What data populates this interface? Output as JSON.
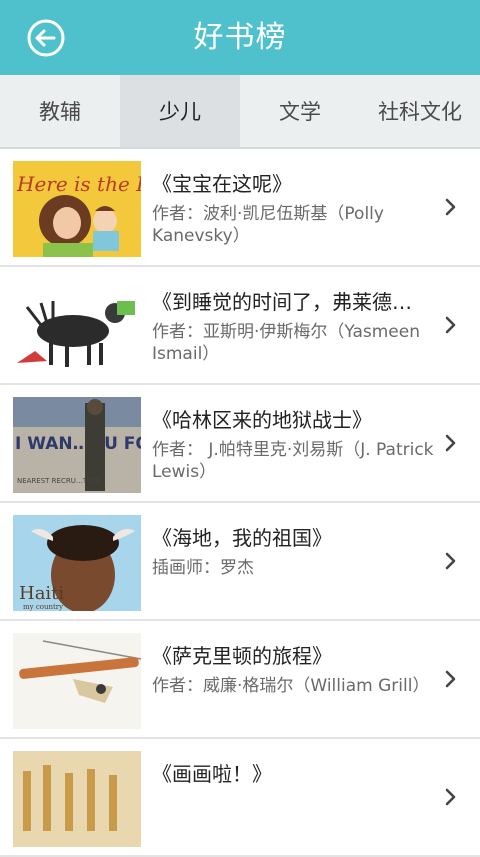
{
  "header": {
    "title": "好书榜"
  },
  "tabs": [
    {
      "label": "教辅",
      "active": false
    },
    {
      "label": "少儿",
      "active": true
    },
    {
      "label": "文学",
      "active": false
    },
    {
      "label": "社科文化",
      "active": false
    }
  ],
  "books": [
    {
      "title": "《宝宝在这呢》",
      "author": "作者：波利·凯尼伍斯基（Polly Kanevsky）",
      "cover_text": "Here is the Baby"
    },
    {
      "title": "《到睡觉的时间了，弗莱德…",
      "author": "作者：亚斯明·伊斯梅尔（Yasmeen Ismail）"
    },
    {
      "title": "《哈林区来的地狱战士》",
      "author": "作者： J.帕特里克·刘易斯（J. Patrick Lewis）",
      "cover_text": "I WAN…OU FOR U.S.…MY",
      "cover_subtext": "NEAREST RECRU…TION"
    },
    {
      "title": "《海地，我的祖国》",
      "author": "插画师：罗杰",
      "cover_text": "Haiti",
      "cover_subtext": "my country"
    },
    {
      "title": "《萨克里顿的旅程》",
      "author": "作者：威廉·格瑞尔（William Grill）"
    },
    {
      "title": "《画画啦！》",
      "author": ""
    }
  ],
  "colors": {
    "header_bg": "#4fc1cc",
    "tab_bg": "#eceff0",
    "tab_active_bg": "#dde0e2"
  },
  "icons": {
    "back": "arrow-left-circle-icon",
    "row_chevron": "chevron-right-icon"
  }
}
